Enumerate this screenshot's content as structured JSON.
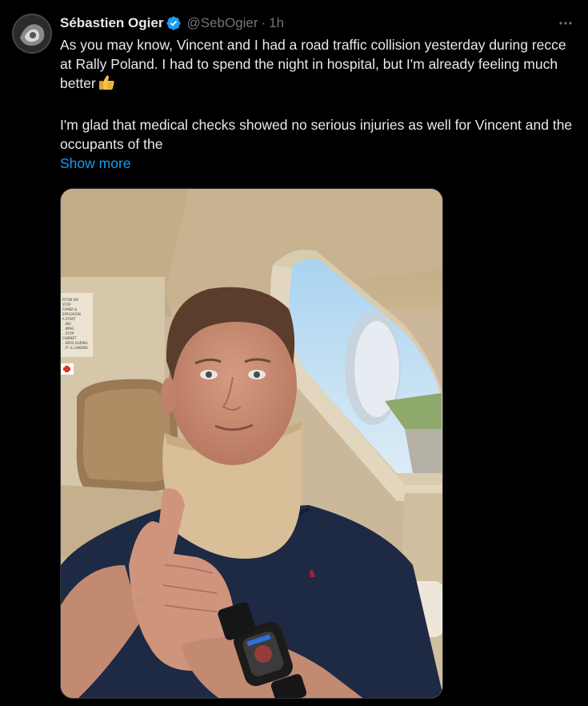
{
  "author": {
    "display_name": "Sébastien Ogier",
    "handle": "@SebOgier",
    "separator": "·",
    "time": "1h",
    "avatar_icon": "avatar-image",
    "verified_icon": "verified-badge-icon"
  },
  "tweet": {
    "paragraph_1": "As you may know, Vincent and I had a road traffic collision yesterday during recce at Rally Poland. I had to spend the night in hospital, but I'm already feeling much better",
    "paragraph_1_emoji": "thumbs-up-emoji",
    "paragraph_2": "I'm glad that medical checks showed no serious injuries as well for Vincent and the occupants of the",
    "show_more": "Show more"
  },
  "media": {
    "image_icon": "selfie-photo",
    "sign_text": [
      "PITON AIR",
      "STOP",
      "FUMER &",
      "EXPLOSION",
      "A START",
      "...ING",
      "...MING",
      "...STOP",
      "CABINET",
      "...BERS DURING",
      "...FF & LANDING"
    ]
  },
  "colors": {
    "background": "#000000",
    "text": "#e7e9ea",
    "secondary": "#71767b",
    "link": "#1d9bf0",
    "verified": "#1d9bf0"
  }
}
